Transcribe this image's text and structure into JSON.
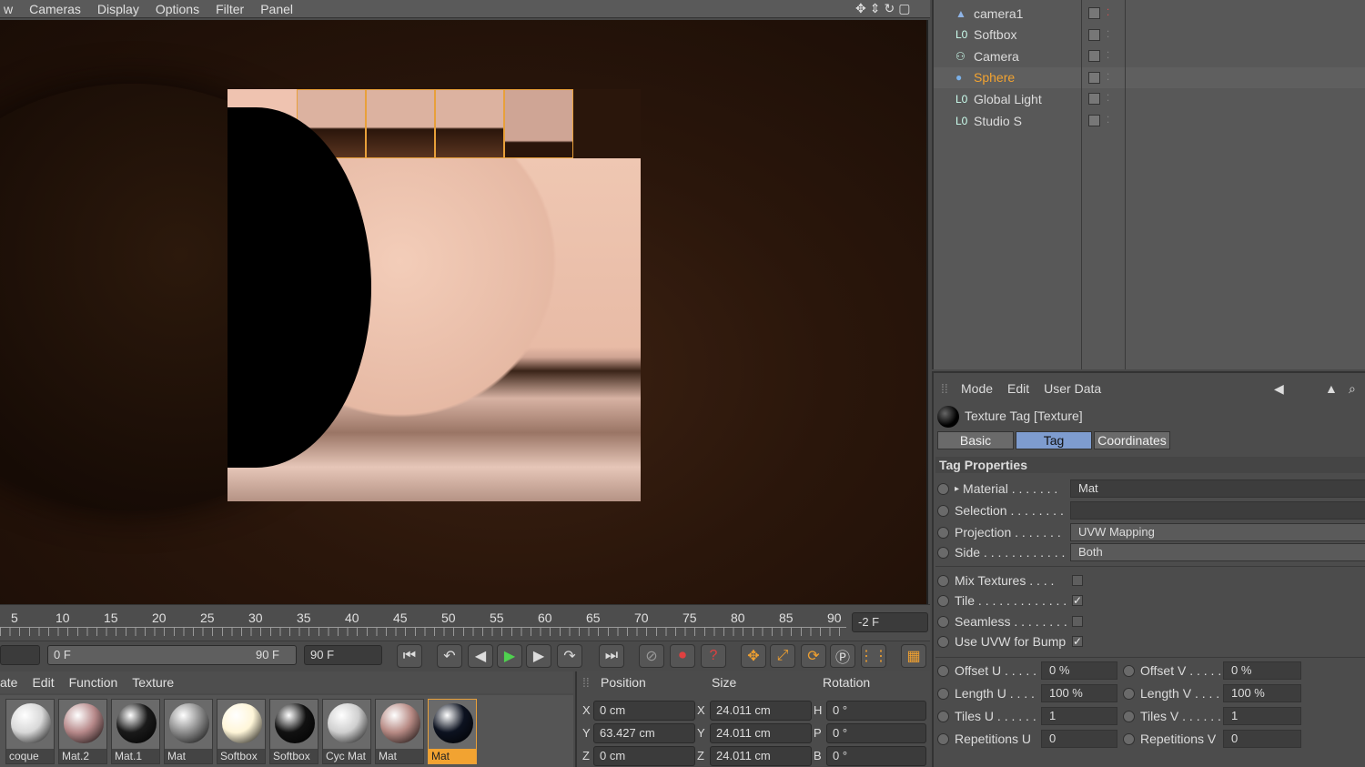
{
  "viewport_menu": [
    "w",
    "Cameras",
    "Display",
    "Options",
    "Filter",
    "Panel"
  ],
  "timeline": {
    "ticks": [
      "5",
      "10",
      "15",
      "20",
      "25",
      "30",
      "35",
      "40",
      "45",
      "50",
      "55",
      "60",
      "65",
      "70",
      "75",
      "80",
      "85",
      "90"
    ],
    "current_frame": "-2 F"
  },
  "transport": {
    "range_start": "0 F",
    "range_end": "90 F",
    "end_frame": "90 F"
  },
  "material_menu": [
    "ate",
    "Edit",
    "Function",
    "Texture"
  ],
  "materials": [
    {
      "label": "coque",
      "color": "#d8d8d8"
    },
    {
      "label": "Mat.2",
      "color": "#b7898a"
    },
    {
      "label": "Mat.1",
      "color": "#1a1a1a"
    },
    {
      "label": "Mat",
      "color": "#8d8d8d"
    },
    {
      "label": "Softbox",
      "color": "#fff6d8"
    },
    {
      "label": "Softbox",
      "color": "#111111"
    },
    {
      "label": "Cyc Mat",
      "color": "#cfcfcf"
    },
    {
      "label": "Mat",
      "color": "#b78a84"
    },
    {
      "label": "Mat",
      "color": "#0c1220",
      "selected": true
    }
  ],
  "coords": {
    "headers": [
      "Position",
      "Size",
      "Rotation"
    ],
    "rows": [
      {
        "axis": "X",
        "pos": "0 cm",
        "size_axis": "X",
        "size": "24.011 cm",
        "rot_axis": "H",
        "rot": "0 °"
      },
      {
        "axis": "Y",
        "pos": "63.427 cm",
        "size_axis": "Y",
        "size": "24.011 cm",
        "rot_axis": "P",
        "rot": "0 °"
      },
      {
        "axis": "Z",
        "pos": "0 cm",
        "size_axis": "Z",
        "size": "24.011 cm",
        "rot_axis": "B",
        "rot": "0 °"
      }
    ]
  },
  "objects": [
    {
      "name": "camera1",
      "icon": "camera-target-icon",
      "highlight": false
    },
    {
      "name": "Softbox",
      "icon": "null-object-icon",
      "highlight": false
    },
    {
      "name": "Camera",
      "icon": "camera-icon",
      "highlight": false
    },
    {
      "name": "Sphere",
      "icon": "sphere-icon",
      "highlight": true
    },
    {
      "name": "Global Light",
      "icon": "null-object-icon",
      "highlight": false
    },
    {
      "name": "Studio S",
      "icon": "null-object-icon",
      "highlight": false
    }
  ],
  "attr": {
    "menu": [
      "Mode",
      "Edit",
      "User Data"
    ],
    "title": "Texture Tag [Texture]",
    "tabs": [
      "Basic",
      "Tag",
      "Coordinates"
    ],
    "active_tab": "Tag",
    "section": "Tag Properties",
    "material_label": "Material . . . . . . .",
    "material_value": "Mat",
    "selection_label": "Selection . . . . . . . .",
    "selection_value": "",
    "projection_label": "Projection . . . . . . .",
    "projection_value": "UVW Mapping",
    "side_label": "Side . . . . . . . . . . . .",
    "side_value": "Both",
    "mix_label": "Mix Textures . . . .",
    "tile_label": "Tile . . . . . . . . . . . . .",
    "seamless_label": "Seamless . . . . . . . .",
    "uvwbump_label": "Use UVW for Bump",
    "offset_u_label": "Offset U . . . . .",
    "offset_u": "0 %",
    "offset_v_label": "Offset V . . . . .",
    "offset_v": "0 %",
    "length_u_label": "Length U . . . .",
    "length_u": "100 %",
    "length_v_label": "Length V . . . .",
    "length_v": "100 %",
    "tiles_u_label": "Tiles U . . . . . .",
    "tiles_u": "1",
    "tiles_v_label": "Tiles V . . . . . .",
    "tiles_v": "1",
    "rep_u_label": "Repetitions U",
    "rep_u": "0",
    "rep_v_label": "Repetitions V",
    "rep_v": "0",
    "checkmark": "✓"
  }
}
